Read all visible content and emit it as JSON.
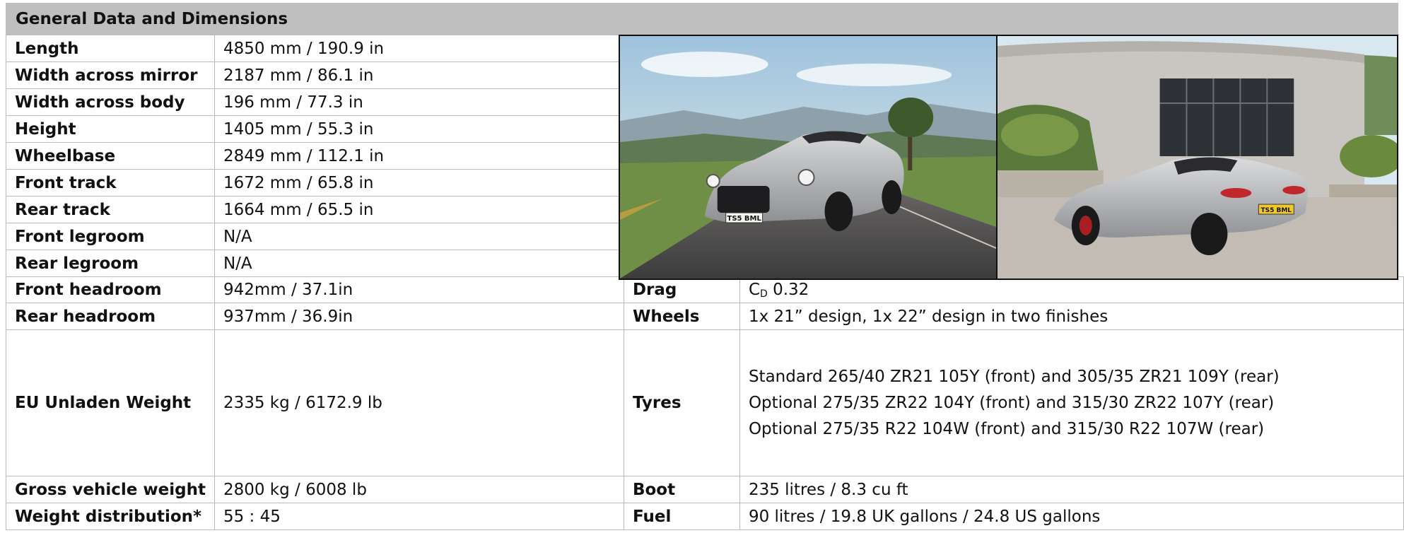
{
  "title": "General Data and Dimensions",
  "left_rows": [
    {
      "label": "Length",
      "value": "4850 mm / 190.9 in"
    },
    {
      "label": "Width across mirror",
      "value": "2187 mm / 86.1 in"
    },
    {
      "label": "Width across body",
      "value": "196 mm / 77.3 in"
    },
    {
      "label": "Height",
      "value": "1405 mm / 55.3 in"
    },
    {
      "label": "Wheelbase",
      "value": "2849 mm / 112.1 in"
    },
    {
      "label": "Front track",
      "value": "1672 mm / 65.8 in"
    },
    {
      "label": "Rear track",
      "value": "1664 mm / 65.5 in"
    },
    {
      "label": "Front legroom",
      "value": "N/A"
    },
    {
      "label": "Rear legroom",
      "value": "N/A"
    },
    {
      "label": "Front headroom",
      "value": "942mm / 37.1in"
    },
    {
      "label": "Rear headroom",
      "value": "937mm / 36.9in"
    },
    {
      "label": "EU Unladen Weight",
      "value": "2335 kg / 6172.9 lb"
    },
    {
      "label": "Gross vehicle weight",
      "value": "2800 kg / 6008 lb"
    },
    {
      "label": "Weight distribution*",
      "value": "55 : 45"
    }
  ],
  "right_rows": {
    "drag": {
      "label": "Drag",
      "prefix": "C",
      "subscript": "D",
      "value": " 0.32"
    },
    "wheels": {
      "label": "Wheels",
      "value": "1x 21” design, 1x 22” design in two finishes"
    },
    "tyres": {
      "label": "Tyres",
      "lines": [
        "Standard 265/40 ZR21 105Y (front) and 305/35 ZR21 109Y (rear)",
        "Optional 275/35 ZR22 104Y (front) and 315/30 ZR22 107Y (rear)",
        "Optional 275/35 R22 104W (front) and 315/30 R22 107W (rear)"
      ]
    },
    "boot": {
      "label": "Boot",
      "value": "235 litres / 8.3 cu ft"
    },
    "fuel": {
      "label": "Fuel",
      "value": "90 litres / 19.8 UK gallons / 24.8 US gallons"
    }
  },
  "photos": {
    "front_plate": "TS5 BML",
    "rear_plate": "TS5 BML"
  },
  "colors": {
    "header_bg": "#bfbfbf",
    "grid_line": "#b9b9b9",
    "car_silver": "#b8b9bb",
    "sky": "#cfe0ec"
  }
}
